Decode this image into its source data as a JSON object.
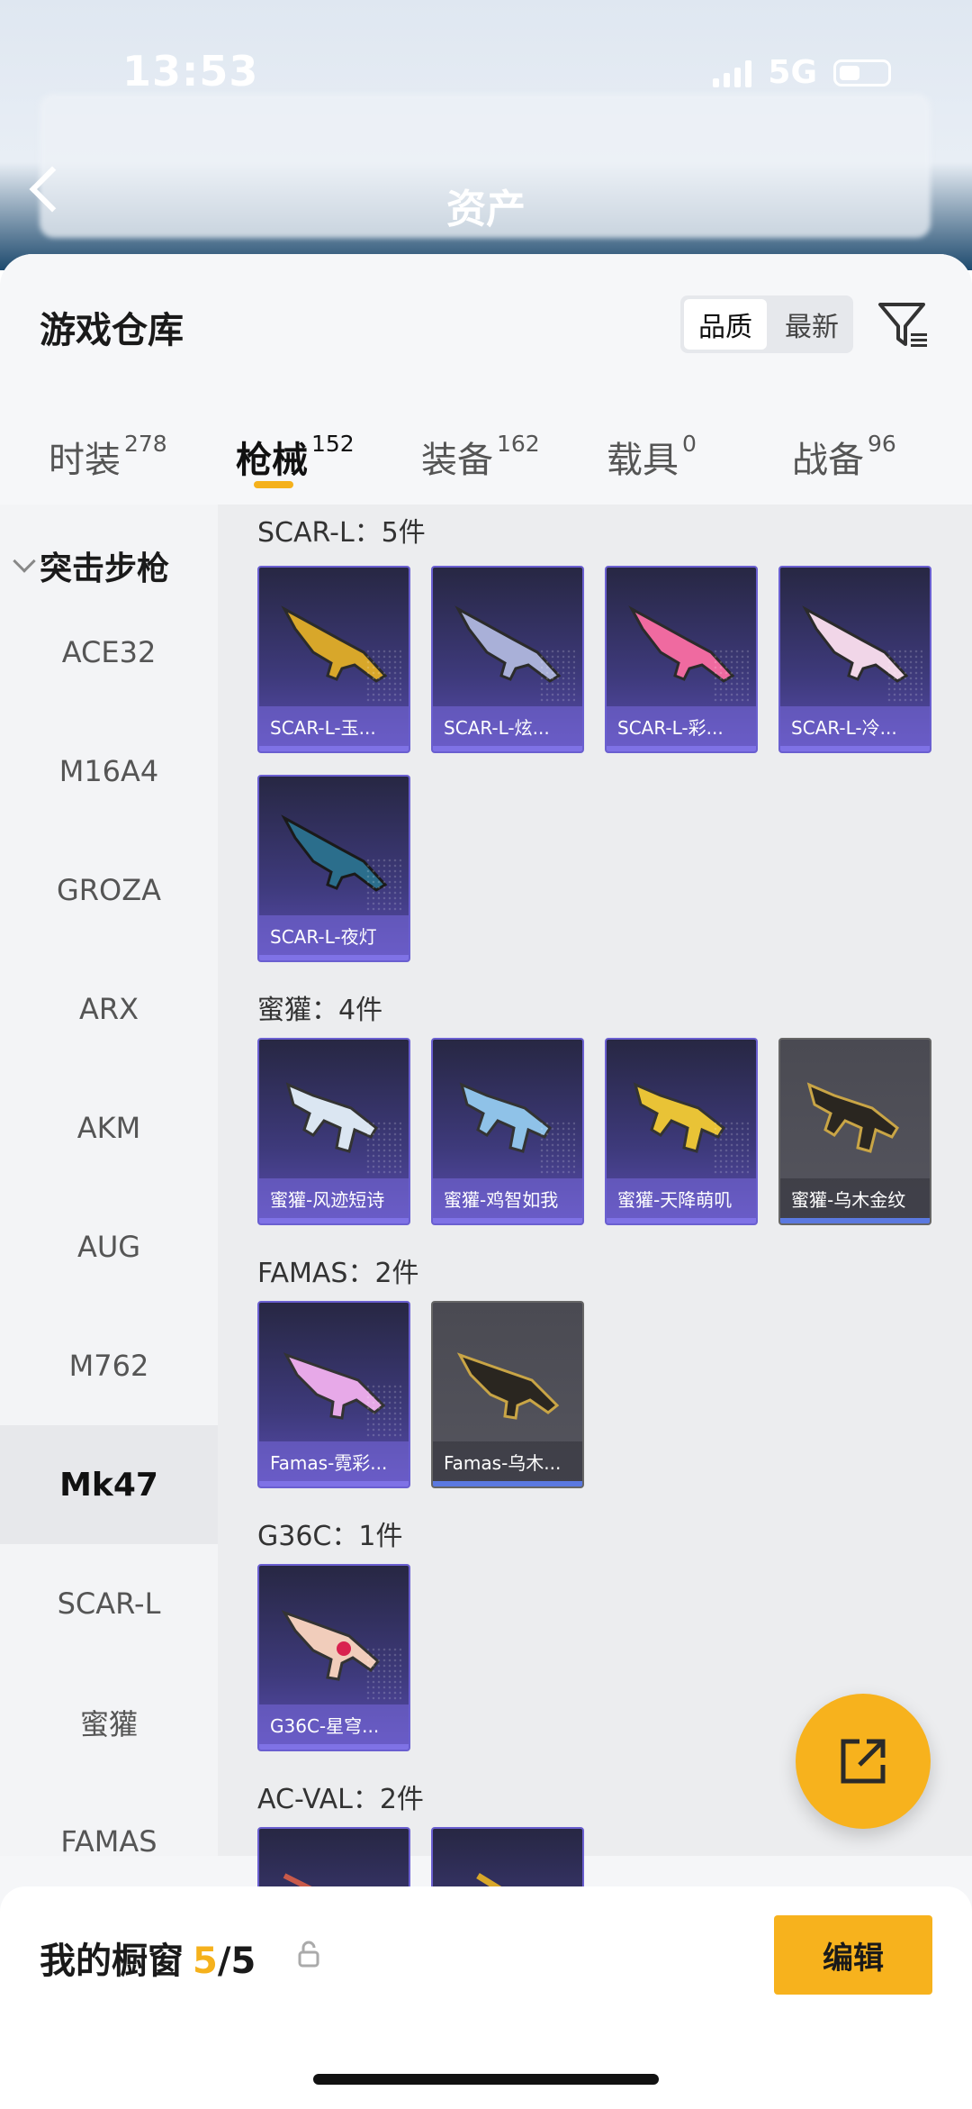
{
  "status_bar": {
    "time": "13:53",
    "network": "5G"
  },
  "background": {
    "title": "资产"
  },
  "sheet": {
    "title": "游戏仓库",
    "sort_options": [
      "品质",
      "最新"
    ],
    "tabs": [
      {
        "label": "时装",
        "count": "278"
      },
      {
        "label": "枪械",
        "count": "152"
      },
      {
        "label": "装备",
        "count": "162"
      },
      {
        "label": "载具",
        "count": "0"
      },
      {
        "label": "战备",
        "count": "96"
      }
    ]
  },
  "sidebar": {
    "category": "突击步枪",
    "items": [
      "ACE32",
      "M16A4",
      "GROZA",
      "ARX",
      "AKM",
      "AUG",
      "M762",
      "Mk47",
      "SCAR-L",
      "蜜獾",
      "FAMAS"
    ],
    "active": "Mk47"
  },
  "groups": [
    {
      "title": "SCAR-L：5件",
      "items": [
        "SCAR-L-玉...",
        "SCAR-L-炫...",
        "SCAR-L-彩...",
        "SCAR-L-冷...",
        "SCAR-L-夜灯"
      ]
    },
    {
      "title": "蜜獾：4件",
      "items": [
        "蜜獾-风迹短诗",
        "蜜獾-鸡智如我",
        "蜜獾-天降萌叽",
        "蜜獾-乌木金纹"
      ]
    },
    {
      "title": "FAMAS：2件",
      "items": [
        "Famas-霓彩...",
        "Famas-乌木..."
      ]
    },
    {
      "title": "G36C：1件",
      "items": [
        "G36C-星穹..."
      ]
    },
    {
      "title": "AC-VAL：2件",
      "items": [
        "",
        ""
      ]
    }
  ],
  "bottom": {
    "title": "我的橱窗",
    "current": "5",
    "total": "/5",
    "edit": "编辑"
  },
  "colors": {
    "accent": "#f7b21d",
    "card_purple": "#4a3f95",
    "card_gray": "#4f4f58"
  }
}
